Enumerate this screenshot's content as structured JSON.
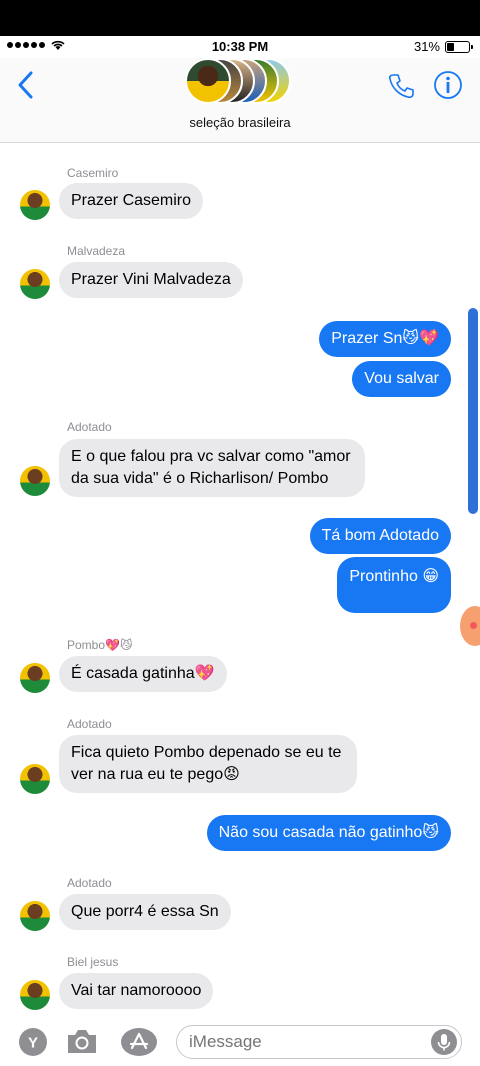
{
  "status_bar": {
    "time": "10:38 PM",
    "battery": "31%",
    "battery_level": 0.31
  },
  "header": {
    "group_name": "seleção brasileira",
    "back_icon": "chevron-left-icon",
    "call_icon": "phone-icon",
    "info_icon": "info-icon"
  },
  "messages": [
    {
      "side": "in",
      "sender": "Casemiro",
      "text": "Prazer Casemiro"
    },
    {
      "side": "in",
      "sender": "Malvadeza",
      "text": "Prazer Vini Malvadeza"
    },
    {
      "side": "out",
      "text": "Prazer Sn😼💖"
    },
    {
      "side": "out",
      "text": "Vou salvar"
    },
    {
      "side": "in",
      "sender": "Adotado",
      "text": "E o que falou pra vc salvar como \"amor da sua vida\" é o Richarlison/ Pombo"
    },
    {
      "side": "out",
      "text": "Tá bom Adotado"
    },
    {
      "side": "out",
      "text": "Prontinho 😁"
    },
    {
      "side": "in",
      "sender": "Pombo💖😼",
      "text": "É casada gatinha💖"
    },
    {
      "side": "in",
      "sender": "Adotado",
      "text": "Fica quieto Pombo depenado se eu te ver na rua eu te pego😡"
    },
    {
      "side": "out",
      "text": "Não sou casada não gatinho😼"
    },
    {
      "side": "in",
      "sender": "Adotado",
      "text": "Que porr4 é essa Sn"
    },
    {
      "side": "in",
      "sender": "Biel jesus",
      "text": "Vai tar namoroooo"
    }
  ],
  "input": {
    "placeholder": "iMessage"
  },
  "colors": {
    "accent": "#1877f2",
    "incoming_bubble": "#e9e9eb",
    "outgoing_bubble": "#1877f2"
  }
}
